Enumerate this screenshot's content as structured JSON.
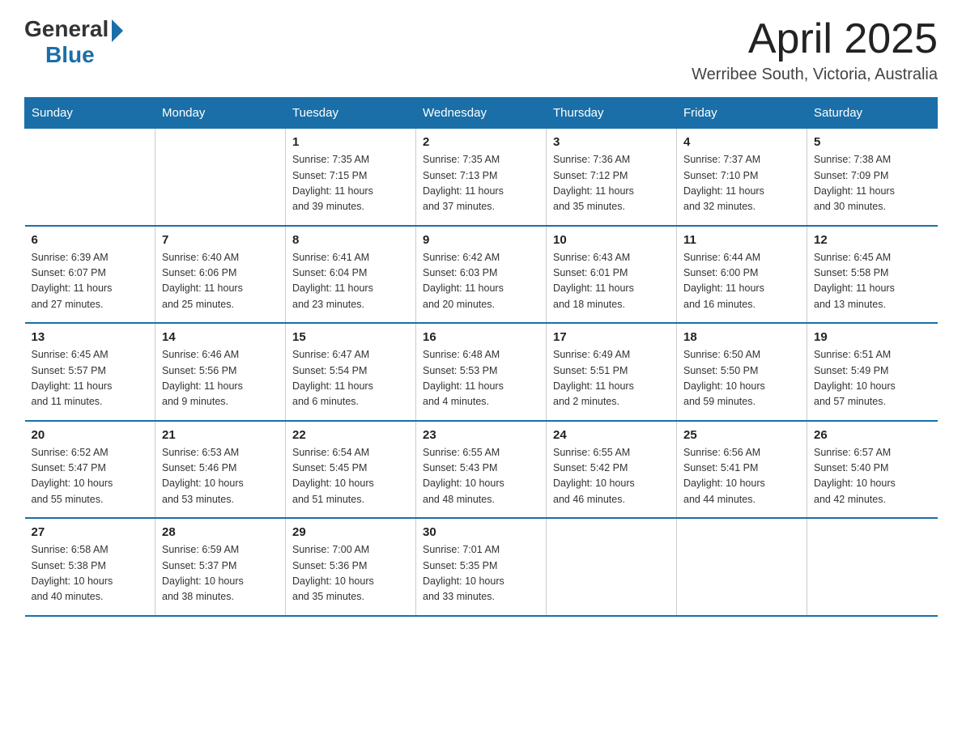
{
  "logo": {
    "general": "General",
    "blue": "Blue"
  },
  "title": "April 2025",
  "location": "Werribee South, Victoria, Australia",
  "days_of_week": [
    "Sunday",
    "Monday",
    "Tuesday",
    "Wednesday",
    "Thursday",
    "Friday",
    "Saturday"
  ],
  "weeks": [
    [
      {
        "day": "",
        "info": ""
      },
      {
        "day": "",
        "info": ""
      },
      {
        "day": "1",
        "info": "Sunrise: 7:35 AM\nSunset: 7:15 PM\nDaylight: 11 hours\nand 39 minutes."
      },
      {
        "day": "2",
        "info": "Sunrise: 7:35 AM\nSunset: 7:13 PM\nDaylight: 11 hours\nand 37 minutes."
      },
      {
        "day": "3",
        "info": "Sunrise: 7:36 AM\nSunset: 7:12 PM\nDaylight: 11 hours\nand 35 minutes."
      },
      {
        "day": "4",
        "info": "Sunrise: 7:37 AM\nSunset: 7:10 PM\nDaylight: 11 hours\nand 32 minutes."
      },
      {
        "day": "5",
        "info": "Sunrise: 7:38 AM\nSunset: 7:09 PM\nDaylight: 11 hours\nand 30 minutes."
      }
    ],
    [
      {
        "day": "6",
        "info": "Sunrise: 6:39 AM\nSunset: 6:07 PM\nDaylight: 11 hours\nand 27 minutes."
      },
      {
        "day": "7",
        "info": "Sunrise: 6:40 AM\nSunset: 6:06 PM\nDaylight: 11 hours\nand 25 minutes."
      },
      {
        "day": "8",
        "info": "Sunrise: 6:41 AM\nSunset: 6:04 PM\nDaylight: 11 hours\nand 23 minutes."
      },
      {
        "day": "9",
        "info": "Sunrise: 6:42 AM\nSunset: 6:03 PM\nDaylight: 11 hours\nand 20 minutes."
      },
      {
        "day": "10",
        "info": "Sunrise: 6:43 AM\nSunset: 6:01 PM\nDaylight: 11 hours\nand 18 minutes."
      },
      {
        "day": "11",
        "info": "Sunrise: 6:44 AM\nSunset: 6:00 PM\nDaylight: 11 hours\nand 16 minutes."
      },
      {
        "day": "12",
        "info": "Sunrise: 6:45 AM\nSunset: 5:58 PM\nDaylight: 11 hours\nand 13 minutes."
      }
    ],
    [
      {
        "day": "13",
        "info": "Sunrise: 6:45 AM\nSunset: 5:57 PM\nDaylight: 11 hours\nand 11 minutes."
      },
      {
        "day": "14",
        "info": "Sunrise: 6:46 AM\nSunset: 5:56 PM\nDaylight: 11 hours\nand 9 minutes."
      },
      {
        "day": "15",
        "info": "Sunrise: 6:47 AM\nSunset: 5:54 PM\nDaylight: 11 hours\nand 6 minutes."
      },
      {
        "day": "16",
        "info": "Sunrise: 6:48 AM\nSunset: 5:53 PM\nDaylight: 11 hours\nand 4 minutes."
      },
      {
        "day": "17",
        "info": "Sunrise: 6:49 AM\nSunset: 5:51 PM\nDaylight: 11 hours\nand 2 minutes."
      },
      {
        "day": "18",
        "info": "Sunrise: 6:50 AM\nSunset: 5:50 PM\nDaylight: 10 hours\nand 59 minutes."
      },
      {
        "day": "19",
        "info": "Sunrise: 6:51 AM\nSunset: 5:49 PM\nDaylight: 10 hours\nand 57 minutes."
      }
    ],
    [
      {
        "day": "20",
        "info": "Sunrise: 6:52 AM\nSunset: 5:47 PM\nDaylight: 10 hours\nand 55 minutes."
      },
      {
        "day": "21",
        "info": "Sunrise: 6:53 AM\nSunset: 5:46 PM\nDaylight: 10 hours\nand 53 minutes."
      },
      {
        "day": "22",
        "info": "Sunrise: 6:54 AM\nSunset: 5:45 PM\nDaylight: 10 hours\nand 51 minutes."
      },
      {
        "day": "23",
        "info": "Sunrise: 6:55 AM\nSunset: 5:43 PM\nDaylight: 10 hours\nand 48 minutes."
      },
      {
        "day": "24",
        "info": "Sunrise: 6:55 AM\nSunset: 5:42 PM\nDaylight: 10 hours\nand 46 minutes."
      },
      {
        "day": "25",
        "info": "Sunrise: 6:56 AM\nSunset: 5:41 PM\nDaylight: 10 hours\nand 44 minutes."
      },
      {
        "day": "26",
        "info": "Sunrise: 6:57 AM\nSunset: 5:40 PM\nDaylight: 10 hours\nand 42 minutes."
      }
    ],
    [
      {
        "day": "27",
        "info": "Sunrise: 6:58 AM\nSunset: 5:38 PM\nDaylight: 10 hours\nand 40 minutes."
      },
      {
        "day": "28",
        "info": "Sunrise: 6:59 AM\nSunset: 5:37 PM\nDaylight: 10 hours\nand 38 minutes."
      },
      {
        "day": "29",
        "info": "Sunrise: 7:00 AM\nSunset: 5:36 PM\nDaylight: 10 hours\nand 35 minutes."
      },
      {
        "day": "30",
        "info": "Sunrise: 7:01 AM\nSunset: 5:35 PM\nDaylight: 10 hours\nand 33 minutes."
      },
      {
        "day": "",
        "info": ""
      },
      {
        "day": "",
        "info": ""
      },
      {
        "day": "",
        "info": ""
      }
    ]
  ]
}
